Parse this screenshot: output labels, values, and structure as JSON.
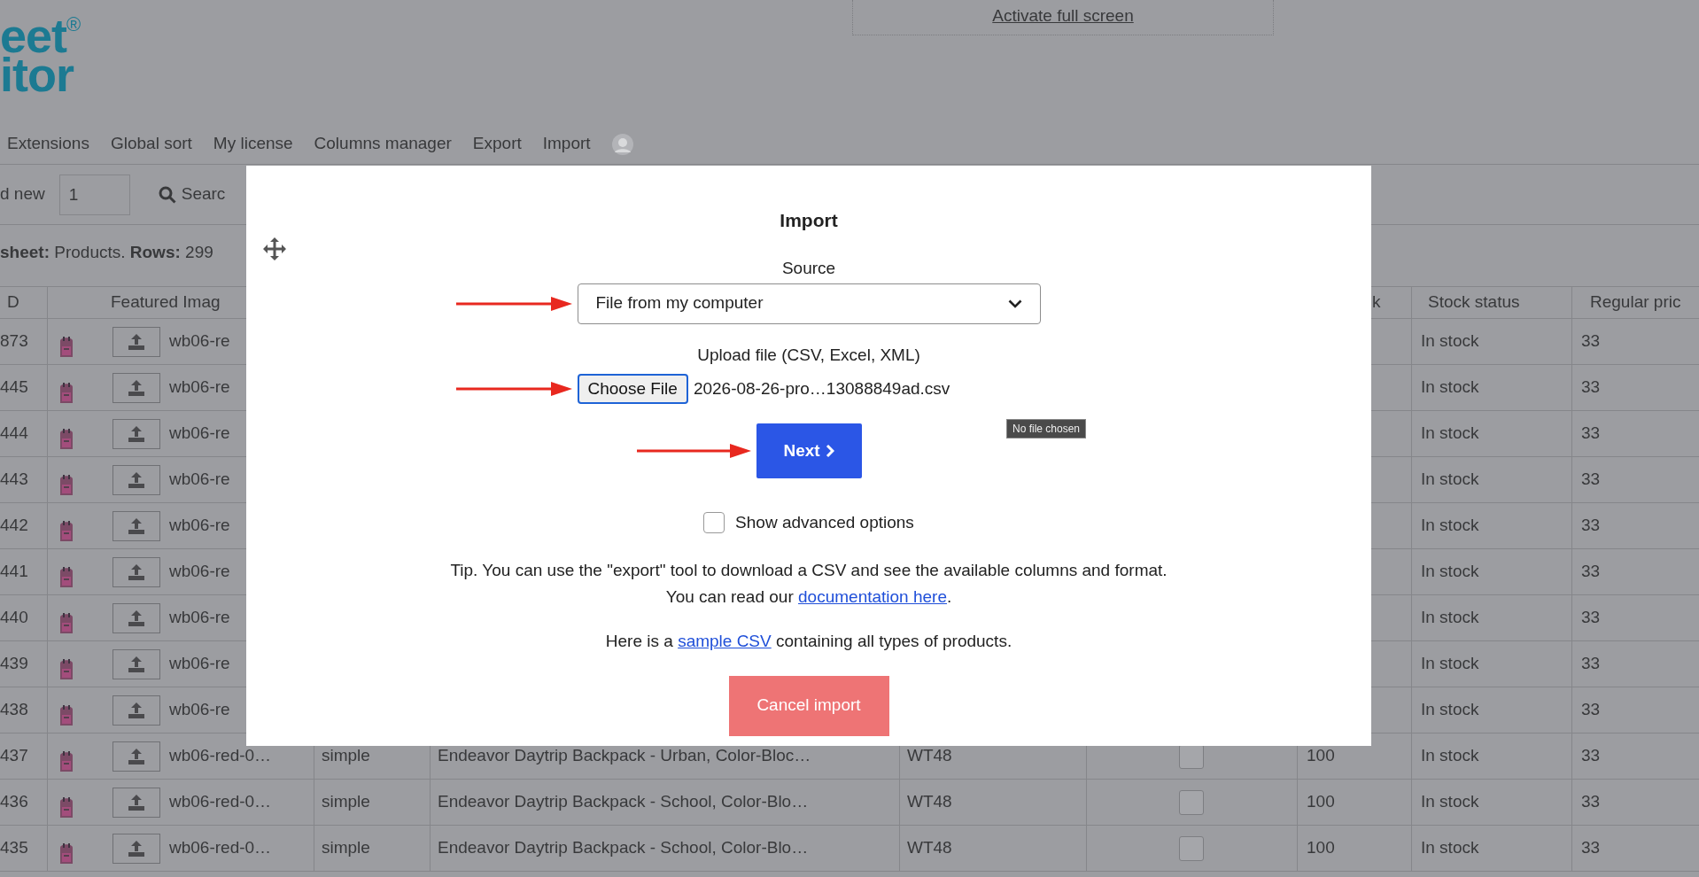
{
  "logo": {
    "line_1": "eet$^{®}$",
    "line_2": "itor"
  },
  "fullscreen_link": "Activate full screen",
  "menu": [
    {
      "label": "Extensions"
    },
    {
      "label": "Global sort"
    },
    {
      "label": "My license"
    },
    {
      "label": "Columns manager"
    },
    {
      "label": "Export"
    },
    {
      "label": "Import"
    }
  ],
  "toolbar": {
    "add_new_label": "d new",
    "add_new_count": "1",
    "search_label": "Searc"
  },
  "sheet_info": "**sheet:** Products. **Rows:** 299",
  "table": {
    "header": {
      "id": "D",
      "featured_image": "Featured Imag",
      "stock": "k",
      "stock_status": "Stock status",
      "regular_price": "Regular pric"
    },
    "rows": [
      {
        "id": "873",
        "sku": "wb06-re",
        "stock_status": "In stock",
        "regular_price": "33"
      },
      {
        "id": "445",
        "sku": "wb06-re",
        "stock_status": "In stock",
        "regular_price": "33"
      },
      {
        "id": "444",
        "sku": "wb06-re",
        "stock_status": "In stock",
        "regular_price": "33"
      },
      {
        "id": "443",
        "sku": "wb06-re",
        "stock_status": "In stock",
        "regular_price": "33"
      },
      {
        "id": "442",
        "sku": "wb06-re",
        "stock_status": "In stock",
        "regular_price": "33"
      },
      {
        "id": "441",
        "sku": "wb06-re",
        "stock_status": "In stock",
        "regular_price": "33"
      },
      {
        "id": "440",
        "sku": "wb06-re",
        "stock_status": "In stock",
        "regular_price": "33"
      },
      {
        "id": "439",
        "sku": "wb06-re",
        "stock_status": "In stock",
        "regular_price": "33"
      },
      {
        "id": "438",
        "sku": "wb06-re",
        "stock_status": "In stock",
        "regular_price": "33"
      },
      {
        "id": "437",
        "sku": "wb06-red-0…",
        "type": "simple",
        "name": "Endeavor Daytrip Backpack - Urban, Color-Bloc…",
        "code": "WT48",
        "checked": false,
        "stock": "100",
        "stock_status": "In stock",
        "regular_price": "33"
      },
      {
        "id": "436",
        "sku": "wb06-red-0…",
        "type": "simple",
        "name": "Endeavor Daytrip Backpack - School, Color-Blo…",
        "code": "WT48",
        "checked": false,
        "stock": "100",
        "stock_status": "In stock",
        "regular_price": "33"
      },
      {
        "id": "435",
        "sku": "wb06-red-0…",
        "type": "simple",
        "name": "Endeavor Daytrip Backpack - School, Color-Blo…",
        "code": "WT48",
        "checked": false,
        "stock": "100",
        "stock_status": "In stock",
        "regular_price": "33"
      }
    ]
  },
  "dialog": {
    "title": "Import",
    "source_label": "Source",
    "source_value": "File from my computer",
    "upload_label": "Upload file (CSV, Excel, XML)",
    "choose_button": "Choose File",
    "file_name": "2026-08-26-pro…13088849ad.csv",
    "tooltip": "No file chosen",
    "next_button": "Next",
    "advanced_label": "Show advanced options",
    "advanced_checked": false,
    "tip_line": "Tip. You can use the \"export\" tool to download a CSV and see the available columns and format.",
    "read_prefix": "You can read our ",
    "read_link": "documentation here",
    "read_suffix": ".",
    "sample_prefix": "Here is a ",
    "sample_link": "sample CSV",
    "sample_suffix": " containing all types of products.",
    "cancel_button": "Cancel import"
  }
}
